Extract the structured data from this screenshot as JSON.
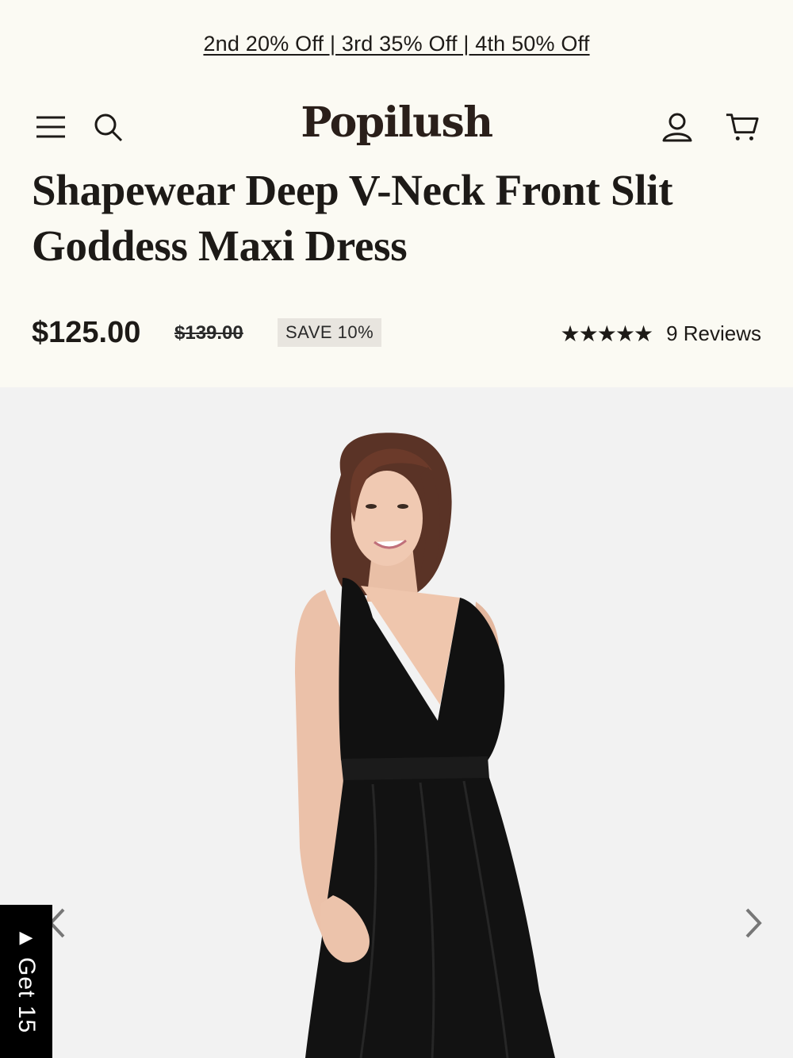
{
  "promo": {
    "text": "2nd 20% Off | 3rd 35% Off | 4th 50% Off"
  },
  "header": {
    "logo": "Popilush",
    "icons": [
      "menu-icon",
      "search-icon",
      "account-icon",
      "cart-icon"
    ]
  },
  "product": {
    "title": "Shapewear Deep V-Neck Front Slit Goddess Maxi Dress",
    "price": "$125.00",
    "compare_price": "$139.00",
    "save_badge": "SAVE 10%",
    "rating": 5,
    "stars": "★★★★★",
    "reviews": "9 Reviews"
  },
  "gallery": {
    "prev_icon": "chevron-left-icon",
    "next_icon": "chevron-right-icon"
  },
  "side_tab": {
    "text": "Get 15"
  },
  "colors": {
    "background": "#fbfaf3",
    "text": "#1d1a17",
    "gallery_bg": "#f2f2f2",
    "badge_bg": "#e8e5df",
    "dress": "#111111"
  }
}
